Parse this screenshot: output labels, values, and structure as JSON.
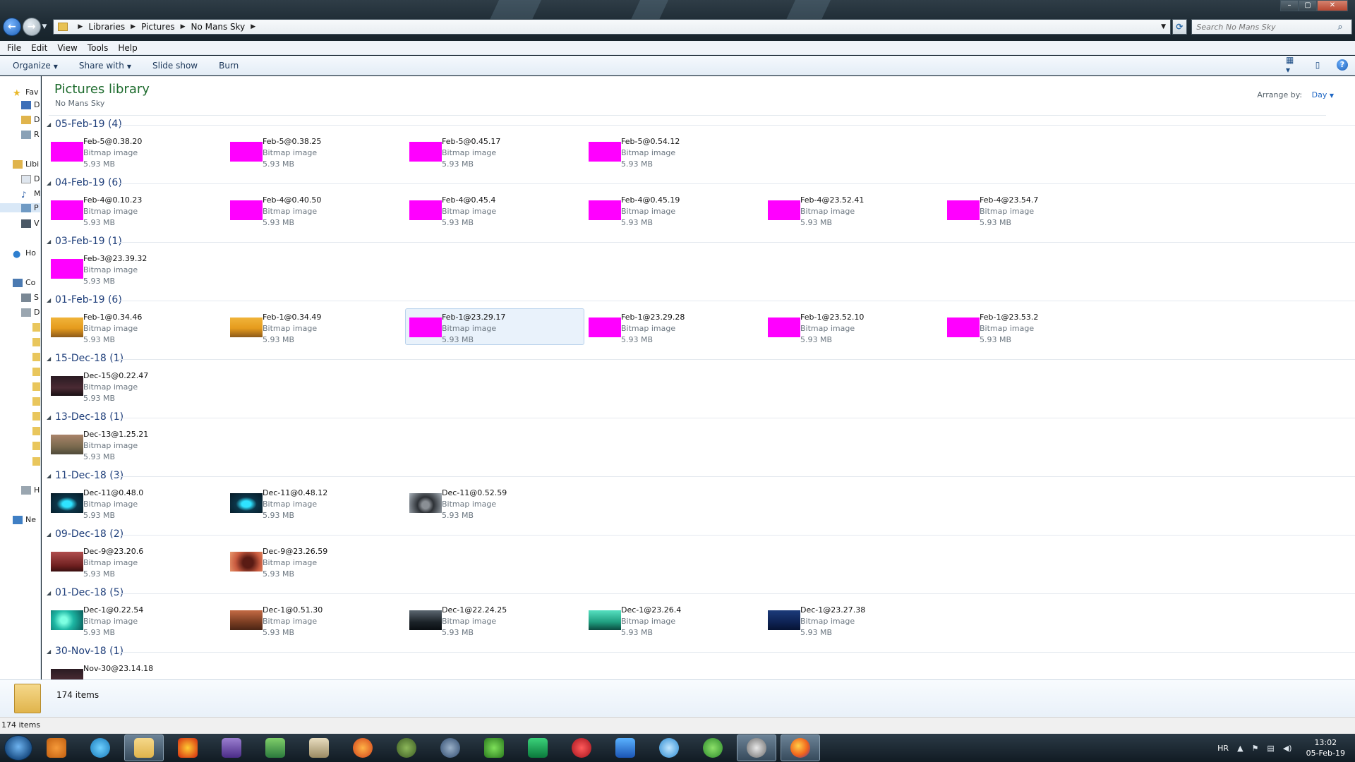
{
  "address_bar": {
    "breadcrumbs": [
      "Libraries",
      "Pictures",
      "No Mans Sky"
    ],
    "search_placeholder": "Search No Mans Sky"
  },
  "menu": [
    "File",
    "Edit",
    "View",
    "Tools",
    "Help"
  ],
  "toolbar": {
    "organize": "Organize",
    "share_with": "Share with",
    "slide_show": "Slide show",
    "burn": "Burn"
  },
  "nav_pane": {
    "favorites": "Fav",
    "fav_items": [
      "D",
      "D",
      "R"
    ],
    "libraries": "Libi",
    "lib_items": [
      "D",
      "M",
      "P",
      "V"
    ],
    "homegroup": "Ho",
    "computer": "Co",
    "comp_items": [
      "S",
      "D",
      "H"
    ],
    "network": "Ne"
  },
  "library": {
    "title": "Pictures library",
    "subtitle": "No Mans Sky",
    "arrange_label": "Arrange by:",
    "arrange_value": "Day"
  },
  "groups": [
    {
      "label": "05-Feb-19 (4)",
      "items": [
        {
          "name": "Feb-5@0.38.20",
          "type": "Bitmap image",
          "size": "5.93 MB",
          "thumb": "magenta"
        },
        {
          "name": "Feb-5@0.38.25",
          "type": "Bitmap image",
          "size": "5.93 MB",
          "thumb": "magenta"
        },
        {
          "name": "Feb-5@0.45.17",
          "type": "Bitmap image",
          "size": "5.93 MB",
          "thumb": "magenta"
        },
        {
          "name": "Feb-5@0.54.12",
          "type": "Bitmap image",
          "size": "5.93 MB",
          "thumb": "magenta"
        }
      ]
    },
    {
      "label": "04-Feb-19 (6)",
      "items": [
        {
          "name": "Feb-4@0.10.23",
          "type": "Bitmap image",
          "size": "5.93 MB",
          "thumb": "magenta"
        },
        {
          "name": "Feb-4@0.40.50",
          "type": "Bitmap image",
          "size": "5.93 MB",
          "thumb": "magenta"
        },
        {
          "name": "Feb-4@0.45.4",
          "type": "Bitmap image",
          "size": "5.93 MB",
          "thumb": "magenta"
        },
        {
          "name": "Feb-4@0.45.19",
          "type": "Bitmap image",
          "size": "5.93 MB",
          "thumb": "magenta"
        },
        {
          "name": "Feb-4@23.52.41",
          "type": "Bitmap image",
          "size": "5.93 MB",
          "thumb": "magenta"
        },
        {
          "name": "Feb-4@23.54.7",
          "type": "Bitmap image",
          "size": "5.93 MB",
          "thumb": "magenta"
        }
      ]
    },
    {
      "label": "03-Feb-19 (1)",
      "items": [
        {
          "name": "Feb-3@23.39.32",
          "type": "Bitmap image",
          "size": "5.93 MB",
          "thumb": "magenta"
        }
      ]
    },
    {
      "label": "01-Feb-19 (6)",
      "items": [
        {
          "name": "Feb-1@0.34.46",
          "type": "Bitmap image",
          "size": "5.93 MB",
          "thumb": "desert"
        },
        {
          "name": "Feb-1@0.34.49",
          "type": "Bitmap image",
          "size": "5.93 MB",
          "thumb": "desert"
        },
        {
          "name": "Feb-1@23.29.17",
          "type": "Bitmap image",
          "size": "5.93 MB",
          "thumb": "magenta"
        },
        {
          "name": "Feb-1@23.29.28",
          "type": "Bitmap image",
          "size": "5.93 MB",
          "thumb": "magenta"
        },
        {
          "name": "Feb-1@23.52.10",
          "type": "Bitmap image",
          "size": "5.93 MB",
          "thumb": "magenta"
        },
        {
          "name": "Feb-1@23.53.2",
          "type": "Bitmap image",
          "size": "5.93 MB",
          "thumb": "magenta"
        }
      ]
    },
    {
      "label": "15-Dec-18 (1)",
      "items": [
        {
          "name": "Dec-15@0.22.47",
          "type": "Bitmap image",
          "size": "5.93 MB",
          "thumb": "dark"
        }
      ]
    },
    {
      "label": "13-Dec-18 (1)",
      "items": [
        {
          "name": "Dec-13@1.25.21",
          "type": "Bitmap image",
          "size": "5.93 MB",
          "thumb": "creature"
        }
      ]
    },
    {
      "label": "11-Dec-18 (3)",
      "items": [
        {
          "name": "Dec-11@0.48.0",
          "type": "Bitmap image",
          "size": "5.93 MB",
          "thumb": "neon"
        },
        {
          "name": "Dec-11@0.48.12",
          "type": "Bitmap image",
          "size": "5.93 MB",
          "thumb": "neon"
        },
        {
          "name": "Dec-11@0.52.59",
          "type": "Bitmap image",
          "size": "5.93 MB",
          "thumb": "portal"
        }
      ]
    },
    {
      "label": "09-Dec-18 (2)",
      "items": [
        {
          "name": "Dec-9@23.20.6",
          "type": "Bitmap image",
          "size": "5.93 MB",
          "thumb": "red"
        },
        {
          "name": "Dec-9@23.26.59",
          "type": "Bitmap image",
          "size": "5.93 MB",
          "thumb": "redbeast"
        }
      ]
    },
    {
      "label": "01-Dec-18 (5)",
      "items": [
        {
          "name": "Dec-1@0.22.54",
          "type": "Bitmap image",
          "size": "5.93 MB",
          "thumb": "teal"
        },
        {
          "name": "Dec-1@0.51.30",
          "type": "Bitmap image",
          "size": "5.93 MB",
          "thumb": "rust"
        },
        {
          "name": "Dec-1@22.24.25",
          "type": "Bitmap image",
          "size": "5.93 MB",
          "thumb": "ship"
        },
        {
          "name": "Dec-1@23.26.4",
          "type": "Bitmap image",
          "size": "5.93 MB",
          "thumb": "green"
        },
        {
          "name": "Dec-1@23.27.38",
          "type": "Bitmap image",
          "size": "5.93 MB",
          "thumb": "blue"
        }
      ]
    },
    {
      "label": "30-Nov-18 (1)",
      "items": [
        {
          "name": "Nov-30@23.14.18",
          "type": "",
          "size": "",
          "thumb": "dark"
        }
      ]
    }
  ],
  "selected_item": "Feb-1@23.29.17",
  "details_pane": {
    "count": "174 items"
  },
  "status_bar": {
    "count": "174 items"
  },
  "taskbar": {
    "apps": [
      "media-player",
      "ds4",
      "explorer",
      "flame",
      "cpu-z",
      "excel-map",
      "scanner",
      "ccleaner",
      "tree",
      "steam-shield",
      "vine",
      "vpn-shield",
      "no-entry",
      "malwarebytes",
      "spiral",
      "utorrent",
      "gog",
      "firefox"
    ],
    "active_apps": [
      "explorer",
      "gog",
      "firefox"
    ],
    "language": "HR",
    "time": "13:02",
    "date": "05-Feb-19"
  },
  "colors": {
    "magenta_thumb": "#ff00ff",
    "library_title": "#1d6b2d",
    "group_header": "#1e3e7a",
    "link_blue": "#1e66c4"
  }
}
